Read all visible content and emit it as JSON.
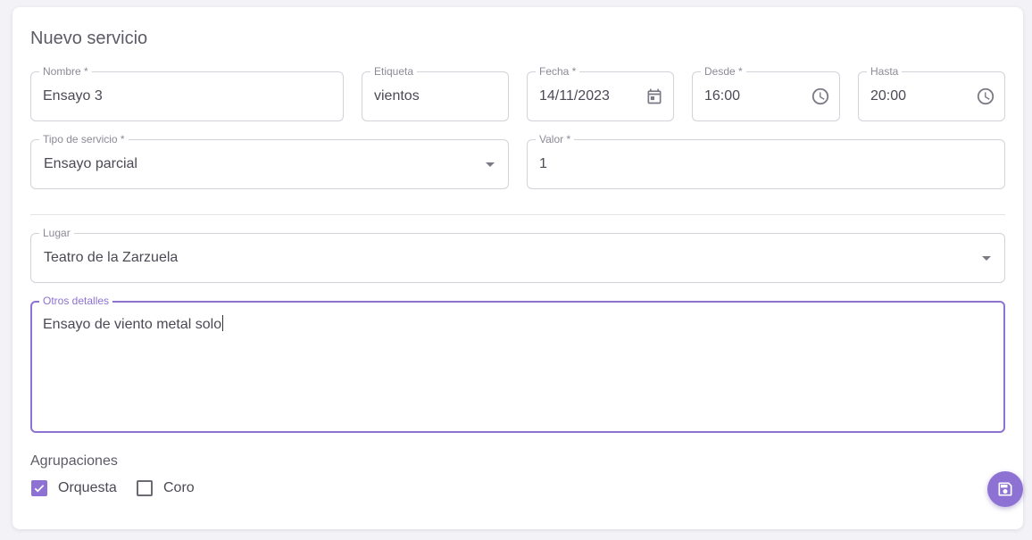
{
  "form": {
    "title": "Nuevo servicio",
    "nombre": {
      "label": "Nombre *",
      "value": "Ensayo 3"
    },
    "etiqueta": {
      "label": "Etiqueta",
      "value": "vientos"
    },
    "fecha": {
      "label": "Fecha *",
      "value": "14/11/2023",
      "icon": "calendar-icon"
    },
    "desde": {
      "label": "Desde *",
      "value": "16:00",
      "icon": "clock-icon"
    },
    "hasta": {
      "label": "Hasta",
      "value": "20:00",
      "icon": "clock-icon"
    },
    "tipo_servicio": {
      "label": "Tipo de servicio *",
      "value": "Ensayo parcial"
    },
    "valor": {
      "label": "Valor *",
      "value": "1"
    },
    "lugar": {
      "label": "Lugar",
      "value": "Teatro de la Zarzuela"
    },
    "otros_detalles": {
      "label": "Otros detalles",
      "value": "Ensayo de viento metal solo"
    },
    "agrupaciones": {
      "title": "Agrupaciones",
      "options": [
        {
          "label": "Orquesta",
          "checked": true
        },
        {
          "label": "Coro",
          "checked": false
        }
      ]
    },
    "save_icon": "save-icon"
  },
  "colors": {
    "accent": "#8d72d4",
    "border": "#d3d2d9",
    "text": "#4b4a55",
    "label": "#8b8a96",
    "background": "#f3f2f6"
  }
}
